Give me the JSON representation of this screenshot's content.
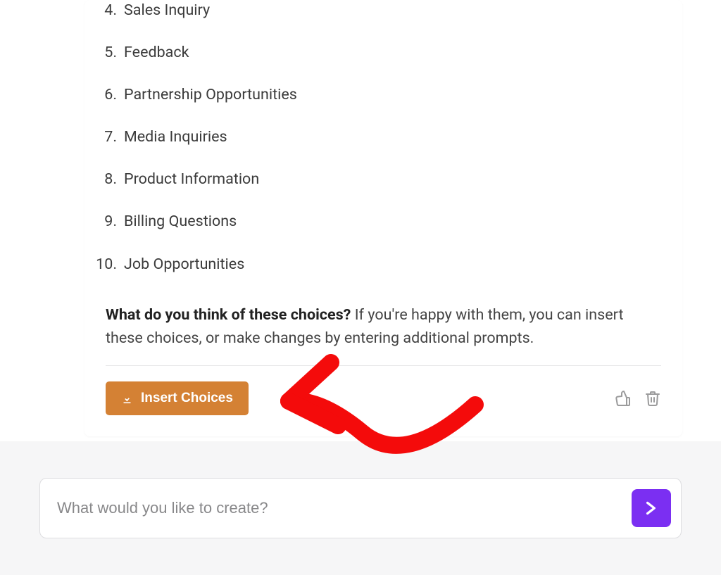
{
  "choices": {
    "startIndex": 4,
    "items": [
      "Sales Inquiry",
      "Feedback",
      "Partnership Opportunities",
      "Media Inquiries",
      "Product Information",
      "Billing Questions",
      "Job Opportunities"
    ]
  },
  "prompt": {
    "bold": "What do you think of these choices?",
    "rest": " If you're happy with them, you can insert these choices, or make changes by entering additional prompts."
  },
  "actions": {
    "insert_label": "Insert Choices"
  },
  "input": {
    "placeholder": "What would you like to create?"
  },
  "colors": {
    "accent_orange": "#d48134",
    "accent_purple": "#7b2ff2",
    "annotation_red": "#f40b0b"
  }
}
